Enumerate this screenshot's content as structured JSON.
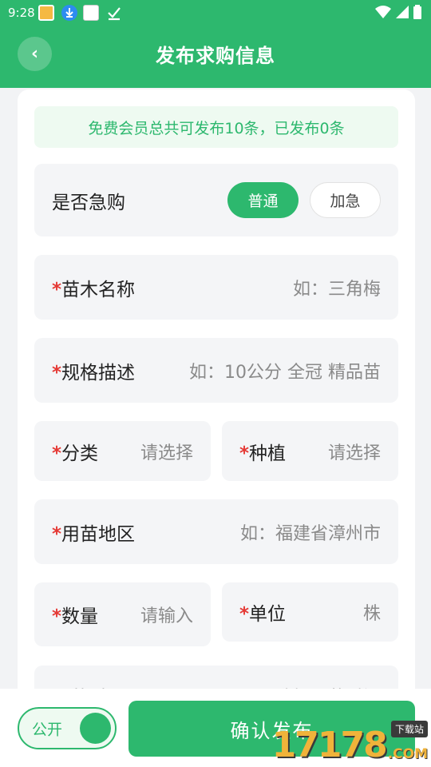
{
  "status_bar": {
    "time": "9:28",
    "app_icons": [
      "notification-app-icon",
      "download-icon",
      "app-badge-icon",
      "check-icon"
    ],
    "right_icons": [
      "wifi-icon",
      "signal-icon",
      "battery-icon"
    ]
  },
  "header": {
    "back_glyph": "‹",
    "title": "发布求购信息"
  },
  "notice": {
    "text": "免费会员总共可发布10条，已发布0条"
  },
  "urgency": {
    "label": "是否急购",
    "options": [
      "普通",
      "加急"
    ],
    "selected": "普通"
  },
  "fields": {
    "name": {
      "required_mark": "*",
      "label": "苗木名称",
      "placeholder": "如：三角梅"
    },
    "spec": {
      "required_mark": "*",
      "label": "规格描述",
      "placeholder": "如：10公分 全冠 精品苗"
    },
    "category": {
      "required_mark": "*",
      "label": "分类",
      "placeholder": "请选择"
    },
    "planting": {
      "required_mark": "*",
      "label": "种植",
      "placeholder": "请选择"
    },
    "region": {
      "required_mark": "*",
      "label": "用苗地区",
      "placeholder": "如：福建省漳州市"
    },
    "quantity": {
      "required_mark": "*",
      "label": "数量",
      "placeholder": "请输入"
    },
    "unit": {
      "required_mark": "*",
      "label": "单位",
      "value": "株"
    },
    "time": {
      "label": "用苗时间",
      "placeholder": "选择用苗时间"
    }
  },
  "bottom": {
    "public_toggle_label": "公开",
    "public_toggle_on": true,
    "confirm_label": "确认发布"
  },
  "watermark": {
    "digits": "17178",
    "domain": ".COM",
    "tag": "下载站"
  },
  "colors": {
    "brand_green": "#2db86e",
    "required_red": "#e53935",
    "field_bg": "#f4f5f7"
  }
}
